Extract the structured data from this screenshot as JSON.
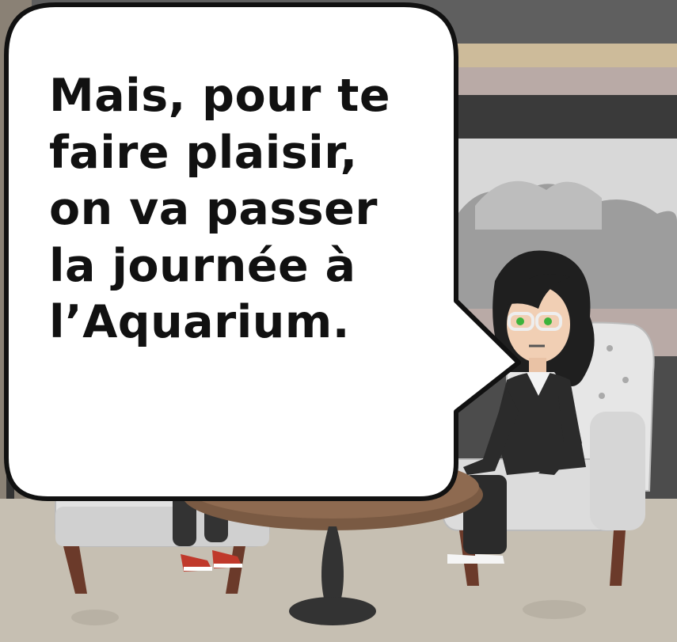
{
  "speech_bubble": {
    "lines": [
      "Mais, pour te",
      "faire plaisir,",
      "on va passer",
      "la journée à",
      "l’Aquarium."
    ]
  },
  "colors": {
    "wall_dark": "#5f5f5f",
    "wall_stripe_pink": "#b9aaa6",
    "floor": "#c6bfb2",
    "armchair": "#dcdcdc",
    "table_top": "#7a5a43",
    "jacket": "#2b2b2b",
    "sneakers": "#c0392b",
    "eyes": "#3bb33b"
  },
  "icons": [
    "speech-bubble",
    "woman-character",
    "armchair",
    "coffee-table"
  ]
}
